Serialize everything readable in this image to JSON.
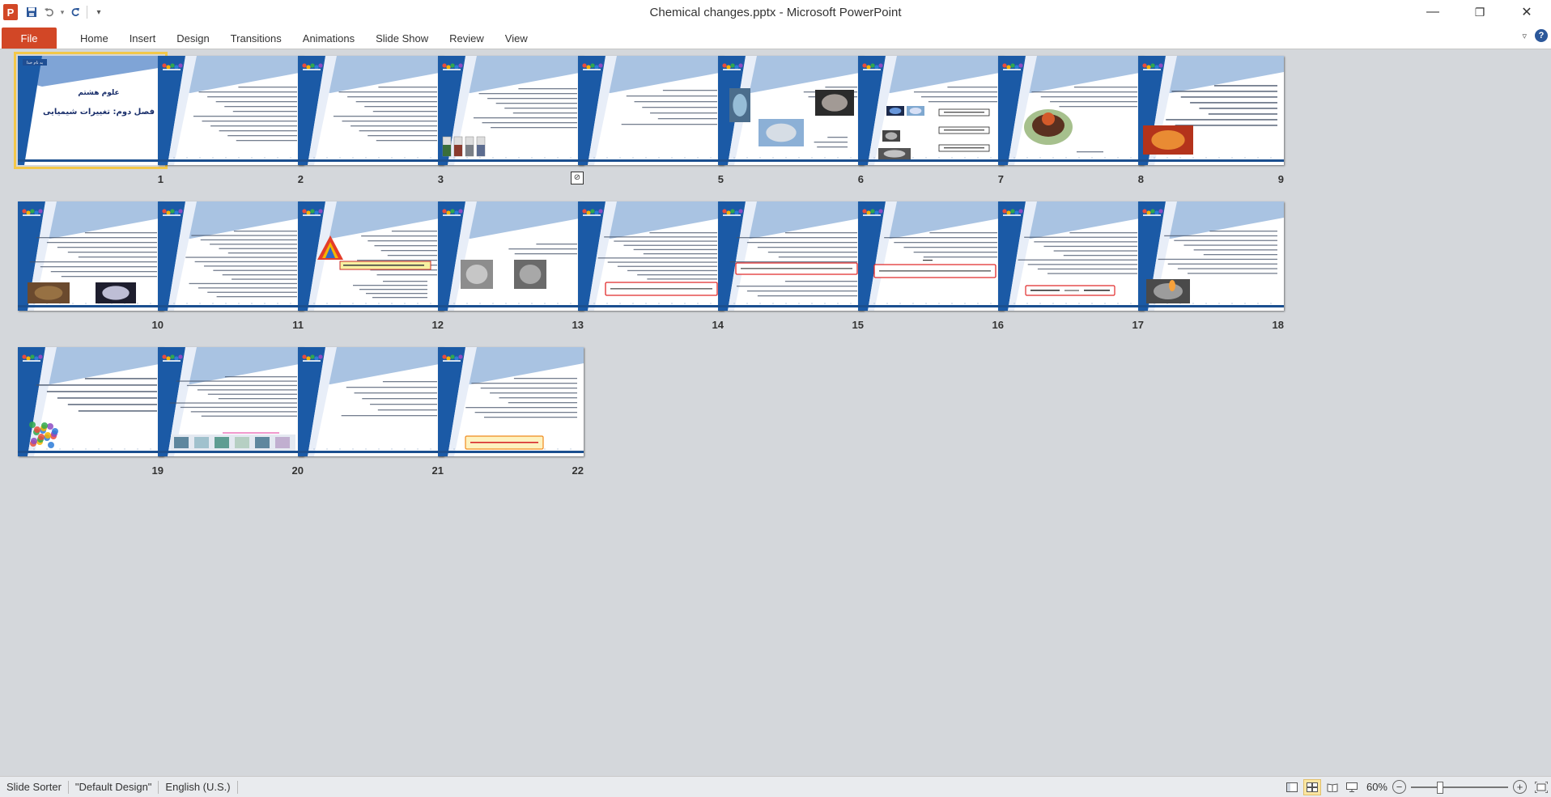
{
  "app": {
    "title": "Chemical changes.pptx  -  Microsoft PowerPoint",
    "logo_letter": "P",
    "qat": {
      "save_icon": "save-icon",
      "undo_icon": "undo-icon",
      "redo_icon": "repeat-icon"
    },
    "window_controls": {
      "minimize": "—",
      "restore": "❐",
      "close": "✕"
    }
  },
  "ribbon": {
    "tabs": [
      {
        "label": "File"
      },
      {
        "label": "Home"
      },
      {
        "label": "Insert"
      },
      {
        "label": "Design"
      },
      {
        "label": "Transitions"
      },
      {
        "label": "Animations"
      },
      {
        "label": "Slide Show"
      },
      {
        "label": "Review"
      },
      {
        "label": "View"
      }
    ],
    "help_glyph": "?"
  },
  "slides": [
    {
      "num": "1",
      "variant": "title",
      "title_line1": "علوم هشتم",
      "title_line2": "فصل دوم: تغییرات شیمیایی",
      "badge": "به نام خدا"
    },
    {
      "num": "2",
      "variant": "text"
    },
    {
      "num": "3",
      "variant": "text"
    },
    {
      "num": "",
      "variant": "text-tubes",
      "hidden": true
    },
    {
      "num": "5",
      "variant": "text-short"
    },
    {
      "num": "6",
      "variant": "photos"
    },
    {
      "num": "7",
      "variant": "boxes"
    },
    {
      "num": "8",
      "variant": "plate"
    },
    {
      "num": "9",
      "variant": "fire"
    },
    {
      "num": "10",
      "variant": "rust"
    },
    {
      "num": "11",
      "variant": "dense"
    },
    {
      "num": "12",
      "variant": "triangle"
    },
    {
      "num": "13",
      "variant": "beakers"
    },
    {
      "num": "14",
      "variant": "redbox-bottom"
    },
    {
      "num": "15",
      "variant": "redbox-mid"
    },
    {
      "num": "16",
      "variant": "redbox-small"
    },
    {
      "num": "17",
      "variant": "equation"
    },
    {
      "num": "18",
      "variant": "flame"
    },
    {
      "num": "19",
      "variant": "protein"
    },
    {
      "num": "20",
      "variant": "cells"
    },
    {
      "num": "21",
      "variant": "text-short"
    },
    {
      "num": "22",
      "variant": "orange-box"
    }
  ],
  "status": {
    "view": "Slide Sorter",
    "theme": "\"Default Design\"",
    "language": "English (U.S.)",
    "zoom": "60%",
    "zoom_level": 0.6
  },
  "colors": {
    "file_tab": "#d24726",
    "slide_blue": "#1b5aa6",
    "slide_light_blue": "#a9c3e2",
    "footer_blue": "#1b4f8f",
    "selection": "#f3c84a"
  }
}
